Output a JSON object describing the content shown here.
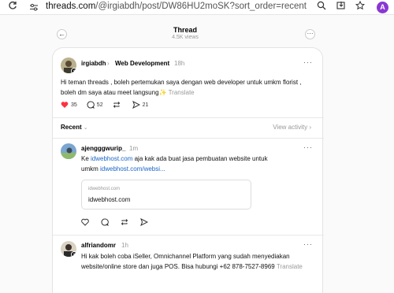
{
  "browser": {
    "url_host": "threads.com",
    "url_path": "/@irgiabdh/post/DW86HU2moSK?sort_order=recent",
    "profile_letter": "A"
  },
  "thread_header": {
    "title": "Thread",
    "views": "4.5K views"
  },
  "post": {
    "username": "irgiabdh",
    "topic": "Web Development",
    "time": "18h",
    "text_line1": "Hi teman threads , boleh pertemukan saya dengan web developer untuk umkm florist ,",
    "text_line2": "boleh dm saya atau meet langsung",
    "sparkle": "✨",
    "translate": "Translate",
    "likes": "35",
    "comments": "52",
    "shares": "21",
    "like_color": "#ff3040"
  },
  "sort": {
    "label": "Recent",
    "view_activity": "View activity"
  },
  "replies": [
    {
      "username": "ajengggwurip_",
      "time": "1m",
      "text_line1_pre": "Ke ",
      "text_line1_link": "idwebhost.com",
      "text_line1_post": " aja kak ada buat jasa pembuatan website untuk",
      "text_line2_pre": "umkm ",
      "text_line2_link": "idwebhost.com/websi...",
      "preview_domain": "idwebhost.com",
      "preview_title": "idwebhost.com"
    },
    {
      "username": "alfriandomr",
      "time": "1h",
      "text_line1": "Hi kak boleh coba iSeller, Omnichannel Platform yang sudah menyediakan",
      "text_line2": "website/online store dan juga POS. Bisa hubungi +62 878-7527-8969",
      "translate": "Translate"
    }
  ]
}
